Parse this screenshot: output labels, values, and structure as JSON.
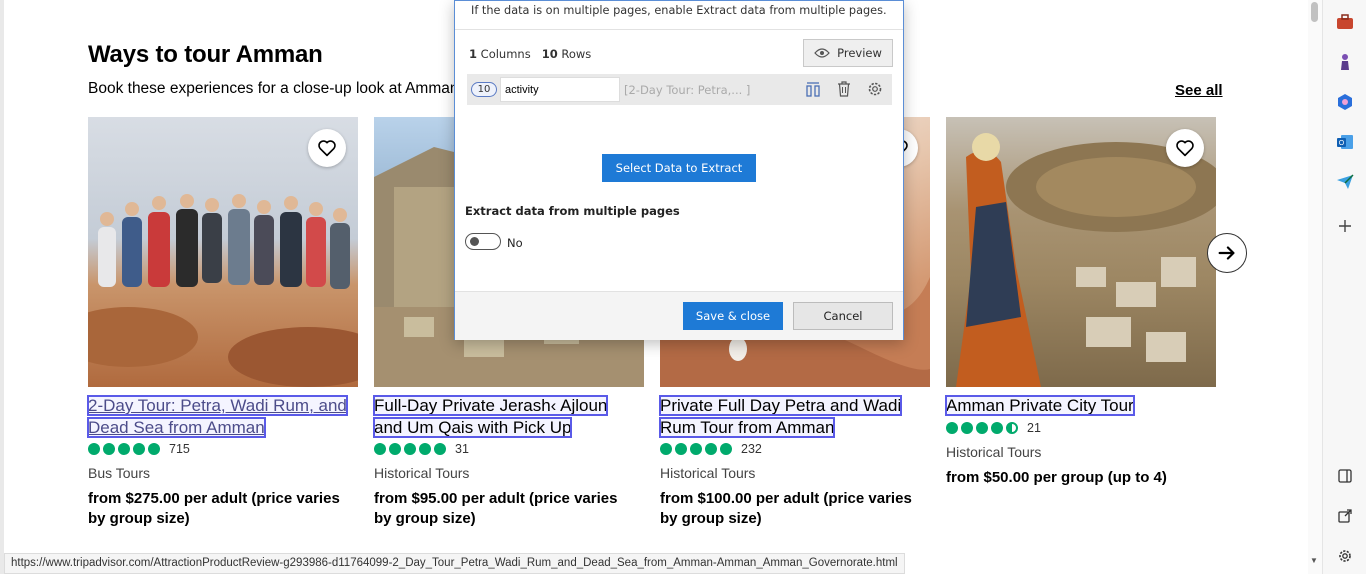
{
  "section": {
    "title": "Ways to tour Amman",
    "subtitle": "Book these experiences for a close-up look at Amman.",
    "see_all": "See all"
  },
  "cards": [
    {
      "title_line1": "2-Day Tour: Petra, Wadi Rum, and",
      "title_line2": "Dead Sea from Amman",
      "rating": 5,
      "reviews": "715",
      "category": "Bus Tours",
      "price_line1": "from $275.00 per adult (price varies",
      "price_line2": "by group size)"
    },
    {
      "title_line1": "Full-Day Private Jerash‹ Ajloun",
      "title_line2": "and Um Qais with Pick Up",
      "rating": 5,
      "reviews": "31",
      "category": "Historical Tours",
      "price_line1": "from $95.00 per adult (price varies",
      "price_line2": "by group size)"
    },
    {
      "title_line1": "Private Full Day Petra and Wadi",
      "title_line2": "Rum Tour from Amman",
      "rating": 5,
      "reviews": "232",
      "category": "Historical Tours",
      "price_line1": "from $100.00 per adult (price varies",
      "price_line2": "by group size)"
    },
    {
      "title_line1": "Amman Private City Tour",
      "title_line2": "",
      "rating": 4.5,
      "reviews": "21",
      "category": "Historical Tours",
      "price_line1": "from $50.00 per group (up to 4)",
      "price_line2": ""
    }
  ],
  "status_url": "https://www.tripadvisor.com/AttractionProductReview-g293986-d11764099-2_Day_Tour_Petra_Wadi_Rum_and_Dead_Sea_from_Amman-Amman_Amman_Governorate.html",
  "dialog": {
    "info": "If the data is on multiple pages, enable Extract data from multiple pages.",
    "columns_count": "1",
    "columns_label": "Columns",
    "rows_count": "10",
    "rows_label": "Rows",
    "preview_label": "Preview",
    "column": {
      "badge": "10",
      "name": "activity",
      "sample": "[2-Day Tour: Petra,...     ]"
    },
    "select_button": "Select Data to Extract",
    "multi_pages_label": "Extract data from multiple pages",
    "toggle_value": "No",
    "save_button": "Save & close",
    "cancel_button": "Cancel"
  },
  "colors": {
    "accent": "#1e7ad6",
    "rating": "#00aa6c",
    "highlight": "#5a5ae8"
  }
}
